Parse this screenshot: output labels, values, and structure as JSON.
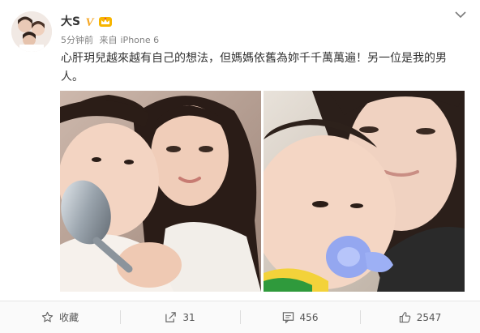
{
  "user": {
    "name": "大S",
    "verified_mark": "V",
    "level_badge": "level-crown-icon"
  },
  "meta": {
    "time": "5分钟前",
    "source_prefix": "来自",
    "source": "iPhone 6"
  },
  "post": {
    "text": "心肝玥兒越來越有自己的想法，但媽媽依舊為妳千千萬萬遍！另一位是我的男人。"
  },
  "actions": {
    "favorite_label": "收藏",
    "repost_count": "31",
    "comment_count": "456",
    "like_count": "2547"
  },
  "colors": {
    "verified": "#f5a623",
    "text": "#333333",
    "meta": "#808080"
  }
}
